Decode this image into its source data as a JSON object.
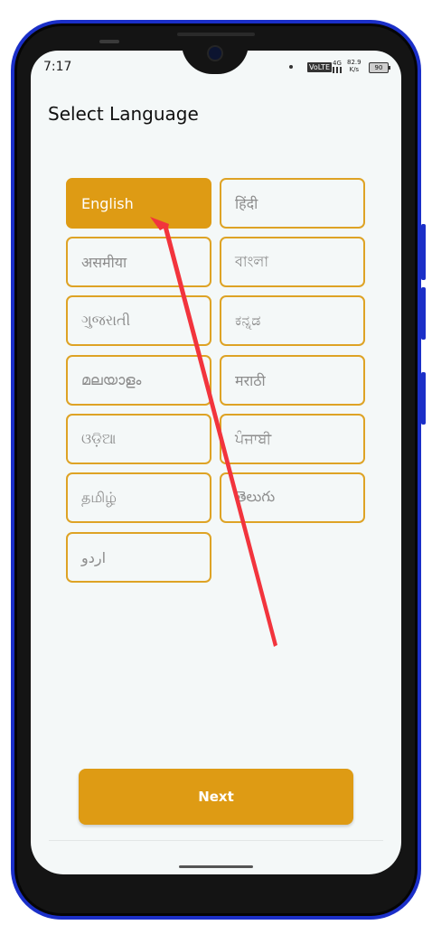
{
  "status_bar": {
    "time": "7:17",
    "volte": "VoLTE",
    "network": "4G",
    "speed_value": "82.9",
    "speed_unit": "K/s",
    "battery": "90"
  },
  "page": {
    "title": "Select Language"
  },
  "languages": [
    {
      "label": "English",
      "selected": true
    },
    {
      "label": "हिंदी",
      "selected": false
    },
    {
      "label": "असमीया",
      "selected": false
    },
    {
      "label": "বাংলা",
      "selected": false
    },
    {
      "label": "ગુજરાતી",
      "selected": false
    },
    {
      "label": "ಕನ್ನಡ",
      "selected": false
    },
    {
      "label": "മലയാളം",
      "selected": false
    },
    {
      "label": "मराठी",
      "selected": false
    },
    {
      "label": "ଓଡ଼ିଆ",
      "selected": false
    },
    {
      "label": "ਪੰਜਾਬੀ",
      "selected": false
    },
    {
      "label": "தமிழ்",
      "selected": false
    },
    {
      "label": "తెలుగు",
      "selected": false
    },
    {
      "label": "اردو",
      "selected": false
    }
  ],
  "actions": {
    "next_label": "Next"
  },
  "colors": {
    "accent": "#de9b14",
    "annotation_arrow": "#f2343d",
    "frame": "#1b2fc8"
  }
}
